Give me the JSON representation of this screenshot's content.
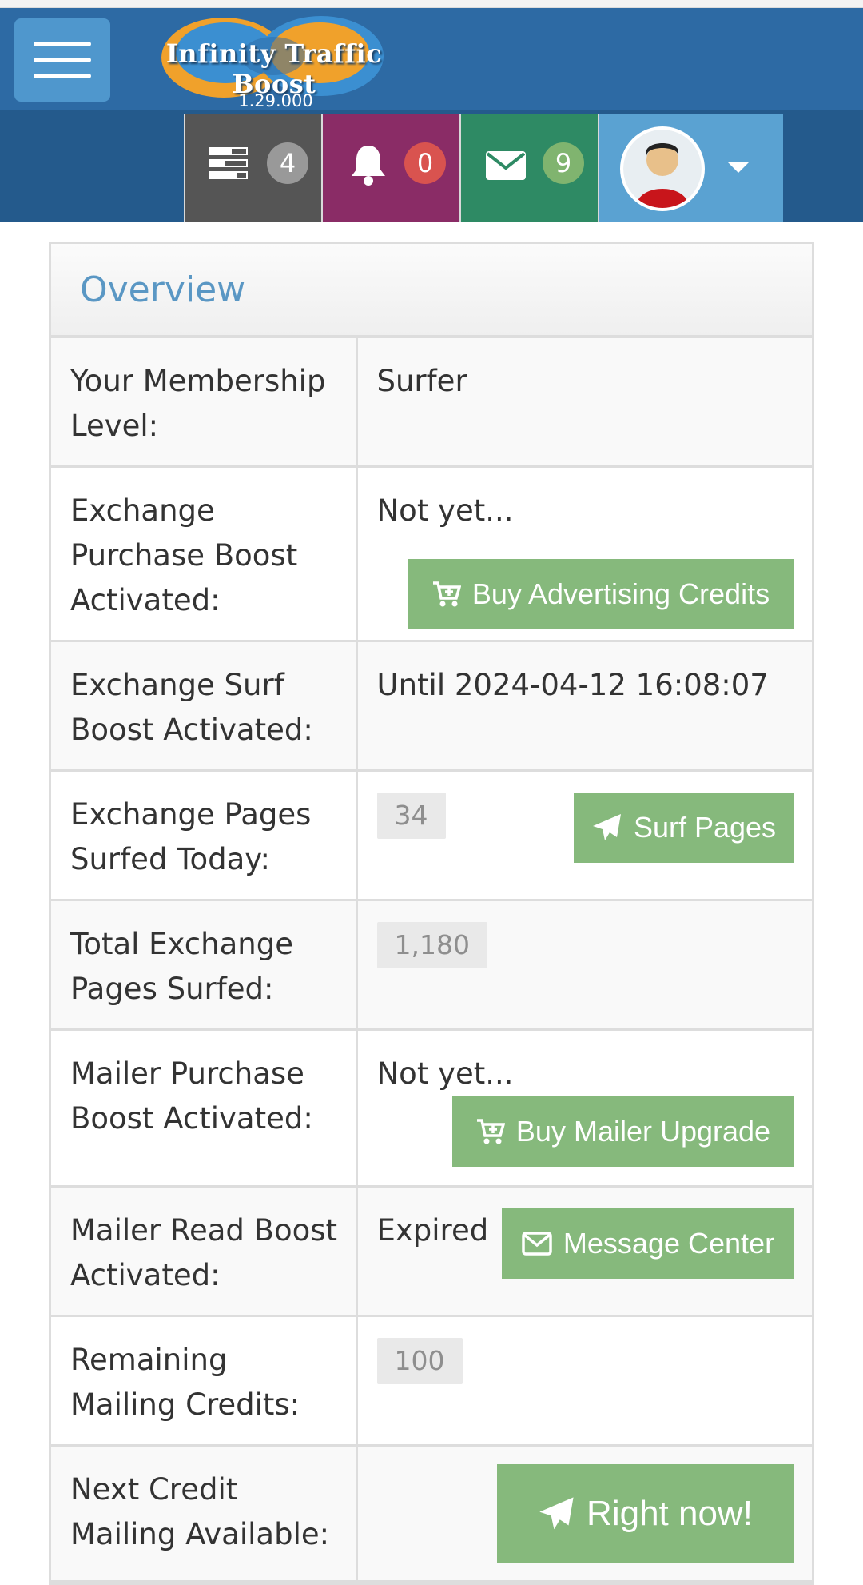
{
  "header": {
    "logo_text": "Infinity Traffic Boost",
    "version": "1.29.000",
    "menu_icon": "hamburger-menu-icon"
  },
  "navbar": {
    "tasks": {
      "icon": "tasks-icon",
      "count": "4",
      "badge_color": "#999999",
      "bg": "#555555"
    },
    "notifications": {
      "icon": "bell-icon",
      "count": "0",
      "badge_color": "#d9534f",
      "bg": "#8a2c66"
    },
    "messages": {
      "icon": "envelope-icon",
      "count": "9",
      "badge_color": "#80b46f",
      "bg": "#2e8a64"
    },
    "user": {
      "icon": "user-avatar",
      "dropdown_icon": "caret-down-icon",
      "bg": "#5aa2d2"
    }
  },
  "overview": {
    "title": "Overview",
    "rows": [
      {
        "label": "Your Membership Level:",
        "value": "Surfer"
      },
      {
        "label": "Exchange Purchase Boost Activated:",
        "value": "Not yet...",
        "button": "Buy Advertising Credits",
        "button_icon": "cart-plus-icon"
      },
      {
        "label": "Exchange Surf Boost Activated:",
        "value": "Until 2024-04-12 16:08:07"
      },
      {
        "label": "Exchange Pages Surfed Today:",
        "pill": "34",
        "button": "Surf Pages",
        "button_icon": "paper-plane-icon"
      },
      {
        "label": "Total Exchange Pages Surfed:",
        "pill": "1,180"
      },
      {
        "label": "Mailer Purchase Boost Activated:",
        "value": "Not yet...",
        "button": "Buy Mailer Upgrade",
        "button_icon": "cart-plus-icon"
      },
      {
        "label": "Mailer Read Boost Activated:",
        "value": "Expired",
        "button": "Message Center",
        "button_icon": "envelope-outline-icon"
      },
      {
        "label": "Remaining Mailing Credits:",
        "pill": "100"
      },
      {
        "label": "Next Credit Mailing Available:",
        "button": "Right now!",
        "button_icon": "paper-plane-icon"
      }
    ]
  },
  "colors": {
    "accent": "#2d6aa4",
    "button": "#86b97c",
    "title": "#5a97c4"
  }
}
